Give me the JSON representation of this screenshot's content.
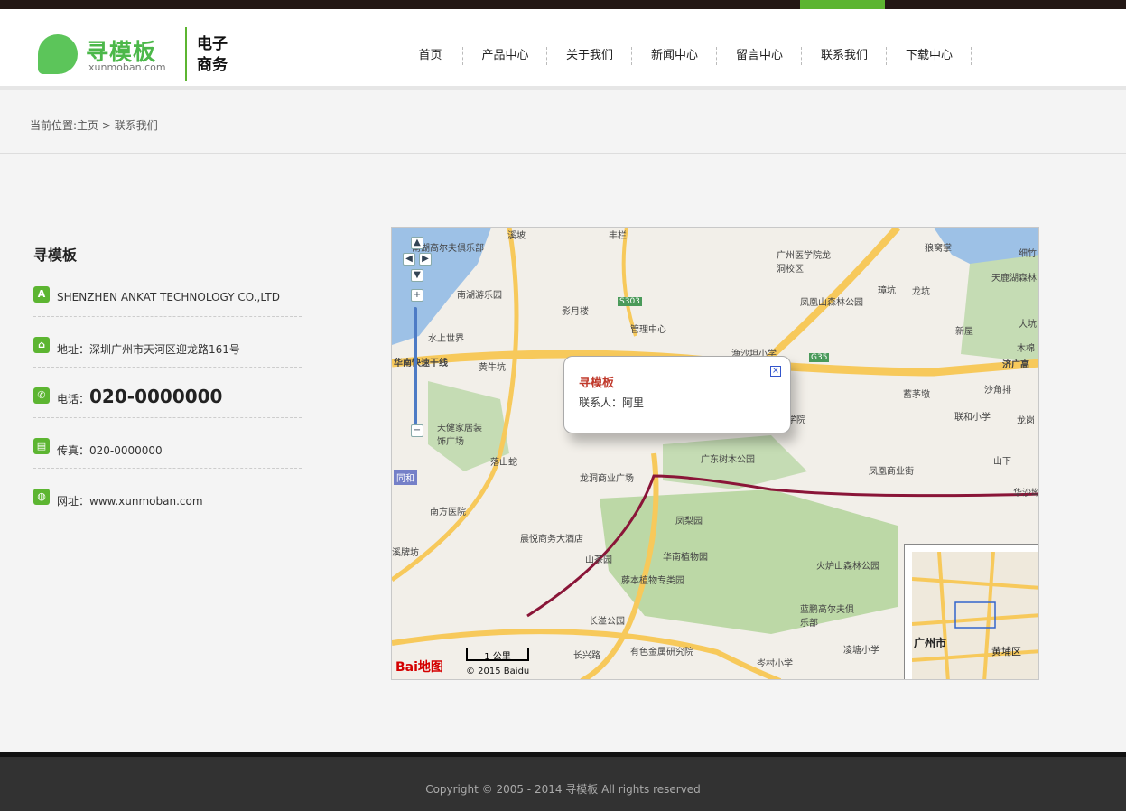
{
  "logo": {
    "name": "寻模板",
    "domain": "xunmoban.com",
    "tag": "电子商务"
  },
  "nav": [
    {
      "label": "首页",
      "active": false
    },
    {
      "label": "产品中心",
      "active": false
    },
    {
      "label": "关于我们",
      "active": false
    },
    {
      "label": "新闻中心",
      "active": false
    },
    {
      "label": "留言中心",
      "active": false
    },
    {
      "label": "联系我们",
      "active": true
    },
    {
      "label": "下载中心",
      "active": false
    }
  ],
  "breadcrumb": {
    "prefix": "当前位置:",
    "home": "主页",
    "separator": " > ",
    "current": "联系我们"
  },
  "contact": {
    "title": "寻模板",
    "company": "SHENZHEN ANKAT TECHNOLOGY CO.,LTD",
    "address_label": "地址：",
    "address": "深圳广州市天河区迎龙路161号",
    "phone_label": "电话：",
    "phone": "020-0000000",
    "fax_label": "传真：",
    "fax": "020-0000000",
    "web_label": "网址：",
    "web": "www.xunmoban.com"
  },
  "icons": {
    "company": "letter-a-icon",
    "address": "home-icon",
    "phone": "phone-icon",
    "fax": "fax-icon",
    "web": "globe-icon"
  },
  "map": {
    "popup_title": "寻模板",
    "popup_contact": "联系人：阿里",
    "scale": "1 公里",
    "copyright": "© 2015 Baidu",
    "baidu": "Bai地图",
    "labels": [
      "南湖高尔夫俱乐部",
      "南湖游乐园",
      "水上世界",
      "华南快速干线",
      "黄牛坑",
      "天健家居装饰广场",
      "落山蛇",
      "同和",
      "南方医院",
      "溪牌坊",
      "晨悦商务大酒店",
      "山茶园",
      "藤本植物专类园",
      "长湴公园",
      "长兴路",
      "有色金属研究院",
      "岑村小学",
      "凌塘小学",
      "蓝鹏高尔夫俱乐部",
      "火炉山森林公园",
      "华南植物园",
      "凤梨园",
      "龙洞商业广场",
      "广东树木公园",
      "凤凰商业街",
      "华沙坳",
      "山下",
      "联和小学",
      "龙岗",
      "蓄茅墩",
      "沙角排",
      "济广高",
      "渔沙坦小学",
      "凤凰山森林公园",
      "广州医学院龙洞校区",
      "管理中心",
      "影月楼",
      "S303",
      "G35",
      "狼窝掌",
      "璋坑",
      "龙坑",
      "天鹿湖森林",
      "新屋",
      "大坑",
      "木棉",
      "细竹",
      "丰栏",
      "学院",
      "溪坡"
    ],
    "overview_city": "广州市",
    "overview_district": "黄埔区"
  },
  "footer": {
    "copyright": "Copyright © 2005 - 2014 寻模板 All rights reserved"
  },
  "colors": {
    "accent": "#5cb531",
    "topbar": "#231815",
    "footer": "#323232"
  }
}
